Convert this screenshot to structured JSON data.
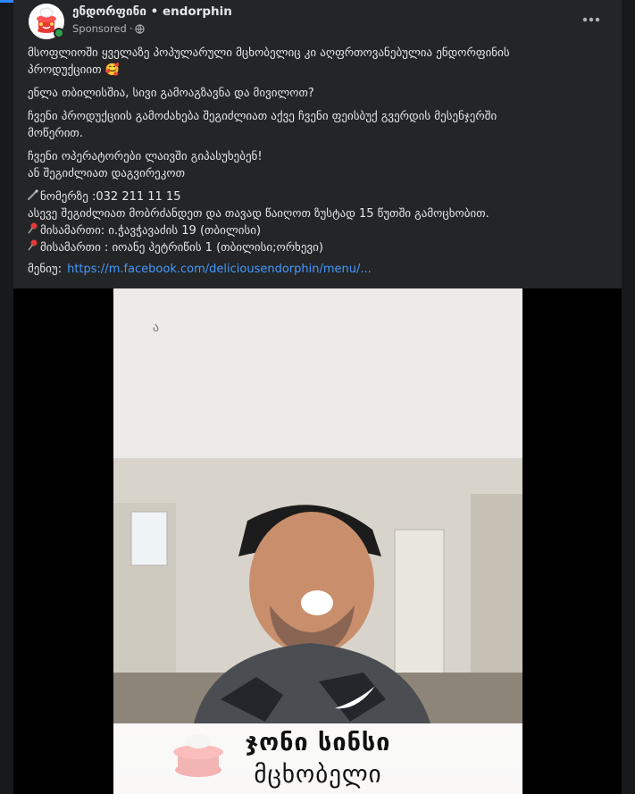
{
  "post": {
    "page_name": "ენდორფინი • endorphin",
    "sponsored_label": "Sponsored",
    "dot": "·",
    "icons": {
      "avatar": "endorphin-logo-icon",
      "globe": "globe-icon",
      "more": "more-options-icon",
      "pin": "round-pushpin-icon",
      "phone": "phone-icon",
      "emoji": "smiling-face-with-hearts-icon"
    },
    "text": {
      "p1_line1": "მსოფლიოში ყველაზე პოპულარული მცხობელიც  კი აღფრთოვანებულია ენდორფინის",
      "p1_line2": "პროდუქციით 🥰",
      "p2": "ენლა თბილისშია, სივი გამოაგზავნა და მივილოთ?",
      "p3_line1": "ჩვენი პროდუქციის გამოძახება შეგიძლიათ აქვე ჩვენი ფეისბუქ გვერდის მესენჯერში",
      "p3_line2": "მოწერით.",
      "p4_line1": "ჩვენი ოპერატორები ლაივში გიპასუხებენ!",
      "p4_line2": "ან შეგიძლიათ დაგვირეკოთ",
      "phone_line": "ნომერზე :032 211 11 15",
      "pickup_line": "ასევე შეგიძლიათ მობრძანდეთ და თავად წაიღოთ ზუსტად 15 წუთში გამოცხობით.",
      "address1": "მისამართი: ი.ჭავჭავაძის 19 (თბილისი)",
      "address2": "მისამართი : იოანე პეტრიწის 1 (თბილისი;ორხევი)",
      "menu_label": "მენიუ:",
      "menu_link": "https://m.facebook.com/deliciousendorphin/menu/..."
    },
    "video": {
      "caption_line1": "ჯონი სინსი",
      "caption_line2": "მცხობელი"
    }
  },
  "colors": {
    "accent": "#2d88ff",
    "link": "#4599ff",
    "online": "#31a24c",
    "card": "#242526"
  }
}
